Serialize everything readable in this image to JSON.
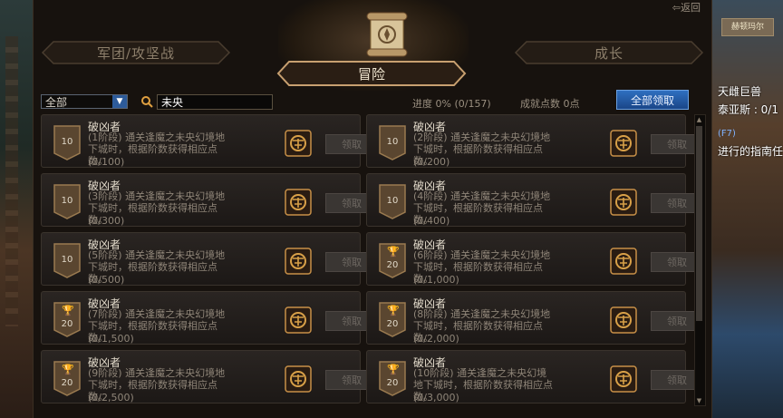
{
  "header": {
    "back_label": "返回",
    "tabs": [
      {
        "label": "军团/攻坚战"
      },
      {
        "label": "冒险"
      },
      {
        "label": "成长"
      }
    ]
  },
  "filter": {
    "category_selected": "全部",
    "search_value": "未央",
    "progress_text": "进度  0% (0/157)",
    "points_text": "成就点数 0点",
    "claim_all_label": "全部领取"
  },
  "achievements": [
    {
      "badge": "10",
      "title": "破凶者",
      "desc": "(1阶段) 通关逢魔之未央幻境地下城时，根据阶数获得相应点数。",
      "count": "(0/100)",
      "claim_label": "领取"
    },
    {
      "badge": "10",
      "title": "破凶者",
      "desc": "(2阶段) 通关逢魔之未央幻境地下城时，根据阶数获得相应点数。",
      "count": "(0/200)",
      "claim_label": "领取"
    },
    {
      "badge": "10",
      "title": "破凶者",
      "desc": "(3阶段) 通关逢魔之未央幻境地下城时，根据阶数获得相应点数。",
      "count": "(0/300)",
      "claim_label": "领取"
    },
    {
      "badge": "10",
      "title": "破凶者",
      "desc": "(4阶段) 通关逢魔之未央幻境地下城时，根据阶数获得相应点数。",
      "count": "(0/400)",
      "claim_label": "领取"
    },
    {
      "badge": "10",
      "title": "破凶者",
      "desc": "(5阶段) 通关逢魔之未央幻境地下城时，根据阶数获得相应点数。",
      "count": "(0/500)",
      "claim_label": "领取"
    },
    {
      "badge": "20",
      "title": "破凶者",
      "desc": "(6阶段) 通关逢魔之未央幻境地下城时，根据阶数获得相应点数。",
      "count": "(0/1,000)",
      "claim_label": "领取"
    },
    {
      "badge": "20",
      "title": "破凶者",
      "desc": "(7阶段) 通关逢魔之未央幻境地下城时，根据阶数获得相应点数。",
      "count": "(0/1,500)",
      "claim_label": "领取"
    },
    {
      "badge": "20",
      "title": "破凶者",
      "desc": "(8阶段) 通关逢魔之未央幻境地下城时，根据阶数获得相应点数。",
      "count": "(0/2,000)",
      "claim_label": "领取"
    },
    {
      "badge": "20",
      "title": "破凶者",
      "desc": "(9阶段) 通关逢魔之未央幻境地下城时，根据阶数获得相应点数。",
      "count": "(0/2,500)",
      "claim_label": "领取"
    },
    {
      "badge": "20",
      "title": "破凶者",
      "desc": "(10阶段) 通关逢魔之未央幻境地下城时，根据阶数获得相应点数。",
      "count": "(0/3,000)",
      "claim_label": "领取"
    }
  ],
  "background_right": {
    "plate": "赫顿玛尔",
    "lines": [
      "天雌巨兽",
      "泰亚斯 : 0/1",
      "(F7)",
      "进行的指南任"
    ]
  },
  "colors": {
    "accent_blue": "#2f6fc0",
    "gold": "#c8a070",
    "panel_bg": "#17120e"
  }
}
